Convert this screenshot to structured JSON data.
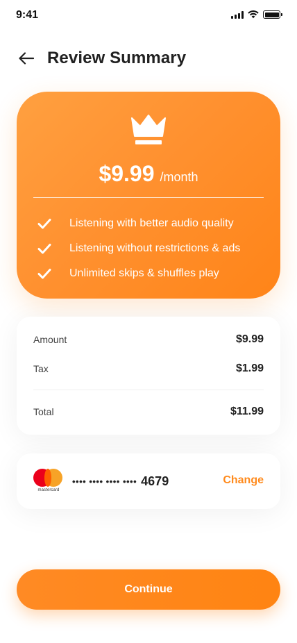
{
  "status_bar": {
    "time": "9:41"
  },
  "header": {
    "title": "Review Summary",
    "back_icon": "arrow-left-icon"
  },
  "plan": {
    "icon": "crown-icon",
    "price": "$9.99",
    "period": "/month",
    "features": [
      "Listening with better audio quality",
      "Listening without restrictions & ads",
      "Unlimited skips & shuffles play"
    ],
    "accent_color": "#ff8a1c"
  },
  "summary": {
    "amount_label": "Amount",
    "amount_value": "$9.99",
    "tax_label": "Tax",
    "tax_value": "$1.99",
    "total_label": "Total",
    "total_value": "$11.99"
  },
  "payment": {
    "brand": "mastercard",
    "masked_number": "•••• •••• •••• ••••",
    "last4": "4679",
    "change_label": "Change"
  },
  "actions": {
    "continue_label": "Continue"
  }
}
